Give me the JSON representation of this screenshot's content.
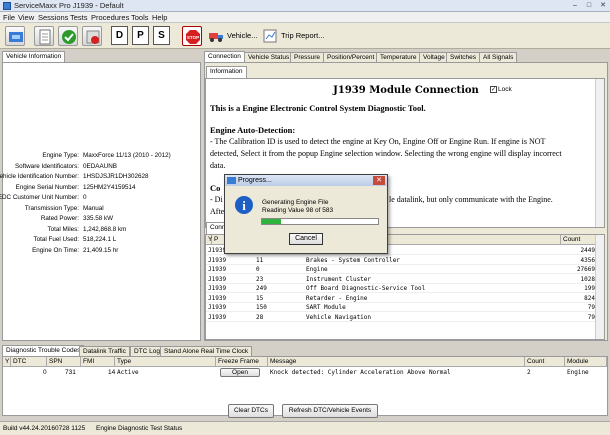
{
  "window": {
    "title": "ServiceMaxx Pro J1939 - Default"
  },
  "menu": [
    "File",
    "View",
    "Sessions",
    "Tests",
    "Procedures",
    "Tools",
    "Help"
  ],
  "toolbar": {
    "letter_buttons": [
      "D",
      "P",
      "S"
    ],
    "vehicle_label": "Vehicle...",
    "trip_label": "Trip Report..."
  },
  "left_panel": {
    "tab": "Vehicle Information",
    "fields": [
      {
        "key": "Engine Type:",
        "value": "MaxxForce 11/13 (2010 - 2012)"
      },
      {
        "key": "Software Identificators:",
        "value": "0EDAAUNB"
      },
      {
        "key": "Vehicle Identification Number:",
        "value": "1HSDJSJR1DH302628"
      },
      {
        "key": "Engine Serial Number:",
        "value": "125HM2Y4159514"
      },
      {
        "key": "EDC Customer Unit Number:",
        "value": "0"
      },
      {
        "key": "Transmission Type:",
        "value": "Manual"
      },
      {
        "key": "Rated Power:",
        "value": "335.58 kW"
      },
      {
        "key": "Total Miles:",
        "value": "1,242,868.8 km"
      },
      {
        "key": "Total Fuel Used:",
        "value": "518,224.1 L"
      },
      {
        "key": "Engine On Time:",
        "value": "21,409.15 hr"
      }
    ]
  },
  "right_tabs": [
    "Connection",
    "Vehicle Status",
    "Pressure",
    "Position/Percent",
    "Temperature",
    "Voltage",
    "Switches",
    "All Signals"
  ],
  "info_tab": "Information",
  "info": {
    "heading": "J1939 Module Connection",
    "lock_label": "Lock",
    "intro": "This is a Engine Electronic Control System Diagnostic Tool.",
    "section1": "Engine Auto-Detection:",
    "para1": [
      "- The Calibration ID is used to detect the engine at Key On, Engine Off or Engine Run. If engine is NOT",
      "detected, Select it from the popup Engine selection window. Selecting the wrong engine will display incorrect",
      "data."
    ],
    "section2_frag": "Co",
    "para2_frag": "- Di",
    "para2_tail": "le datalink, but only communicate with the Engine.",
    "para3_frag": "After"
  },
  "module_table": {
    "tab_frag": "Conn",
    "head_frag": [
      "Y",
      "P"
    ],
    "count_header": "Count",
    "rows": [
      {
        "proto": "J1939",
        "addr": "",
        "name": "",
        "count": "2449"
      },
      {
        "proto": "J1939",
        "addr": "11",
        "name": "Brakes - System Controller",
        "count": "4356"
      },
      {
        "proto": "J1939",
        "addr": "0",
        "name": "Engine",
        "count": "27669"
      },
      {
        "proto": "J1939",
        "addr": "23",
        "name": "Instrument Cluster",
        "count": "1028"
      },
      {
        "proto": "J1939",
        "addr": "249",
        "name": "Off Board Diagnostic-Service Tool",
        "count": "199"
      },
      {
        "proto": "J1939",
        "addr": "15",
        "name": "Retarder - Engine",
        "count": "824"
      },
      {
        "proto": "J1939",
        "addr": "150",
        "name": "SART Module",
        "count": "79"
      },
      {
        "proto": "J1939",
        "addr": "28",
        "name": "Vehicle Navigation",
        "count": "79"
      }
    ]
  },
  "progress_dialog": {
    "title": "Progress...",
    "line1": "Generating Engine File",
    "line2": "Reading Value 98 of 583",
    "progress_fraction": 0.168,
    "cancel_label": "Cancel"
  },
  "bottom_tabs": [
    "Diagnostic Trouble Codes",
    "Datalink Traffic",
    "DTC Log",
    "Stand Alone Real Time Clock"
  ],
  "dtc_table": {
    "headers": [
      "Y",
      "DTC",
      "SPN",
      "FMI",
      "Type",
      "Freeze Frame",
      "Message",
      "Count",
      "Module"
    ],
    "rows": [
      {
        "dtc": "0",
        "spn": "731",
        "fmi": "14",
        "type": "Active",
        "freeze": "Open",
        "message": "Knock detected: Cylinder Acceleration Above Normal",
        "count": "2",
        "module": "Engine"
      }
    ]
  },
  "buttons": {
    "clear": "Clear DTCs",
    "refresh": "Refresh DTC/Vehicle Events"
  },
  "statusbar": {
    "build": "Build v44.24.20160728 1125",
    "test": "Engine Diagnostic Test Status"
  },
  "colors": {
    "progress": "#2fb33c",
    "stop": "#d62020",
    "check": "#2b9a2b"
  }
}
